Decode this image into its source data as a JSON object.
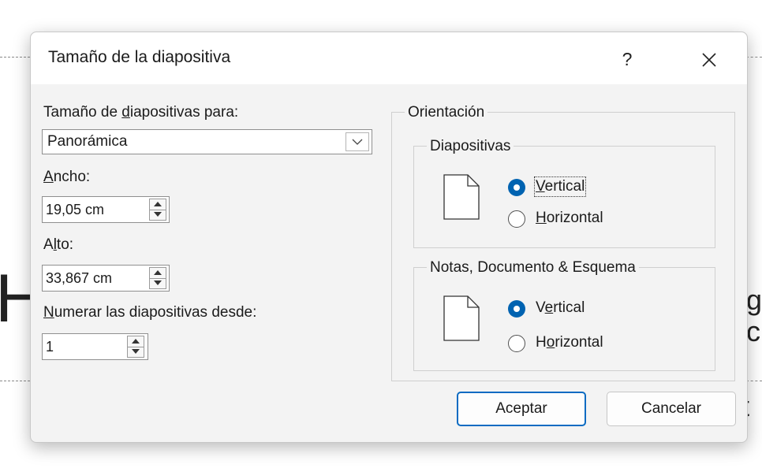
{
  "background": {
    "glyph_left": "H",
    "glyph_right_top": "g",
    "glyph_right_mid": "c",
    "glyph_right_bottom": "ít"
  },
  "dialog": {
    "title": "Tamaño de la diapositiva",
    "help_label": "?",
    "close_label": "✕"
  },
  "slide_size": {
    "label_pre": "Tamaño de ",
    "label_mnemonic": "d",
    "label_post": "iapositivas para:",
    "value": "Panorámica"
  },
  "width": {
    "label_mnemonic": "A",
    "label_post": "ncho:",
    "value": "19,05 cm"
  },
  "height": {
    "label_pre": "A",
    "label_mnemonic": "l",
    "label_post": "to:",
    "value": "33,867 cm"
  },
  "numbering": {
    "label_mnemonic": "N",
    "label_post": "umerar las diapositivas desde:",
    "value": "1"
  },
  "orientation": {
    "title": "Orientación",
    "slides": {
      "title": "Diapositivas",
      "vertical_mnemonic": "V",
      "vertical_post": "ertical",
      "horizontal_mnemonic": "H",
      "horizontal_post": "orizontal",
      "selected": "vertical"
    },
    "notes": {
      "title": "Notas, Documento & Esquema",
      "vertical_pre": "V",
      "vertical_mnemonic": "e",
      "vertical_post": "rtical",
      "horizontal_pre": "H",
      "horizontal_mnemonic": "o",
      "horizontal_post": "rizontal",
      "selected": "vertical"
    }
  },
  "buttons": {
    "ok": "Aceptar",
    "cancel": "Cancelar"
  },
  "colors": {
    "accent": "#0063b1",
    "primary_border": "#0b6bc2",
    "dialog_bg": "#f3f3f3"
  }
}
